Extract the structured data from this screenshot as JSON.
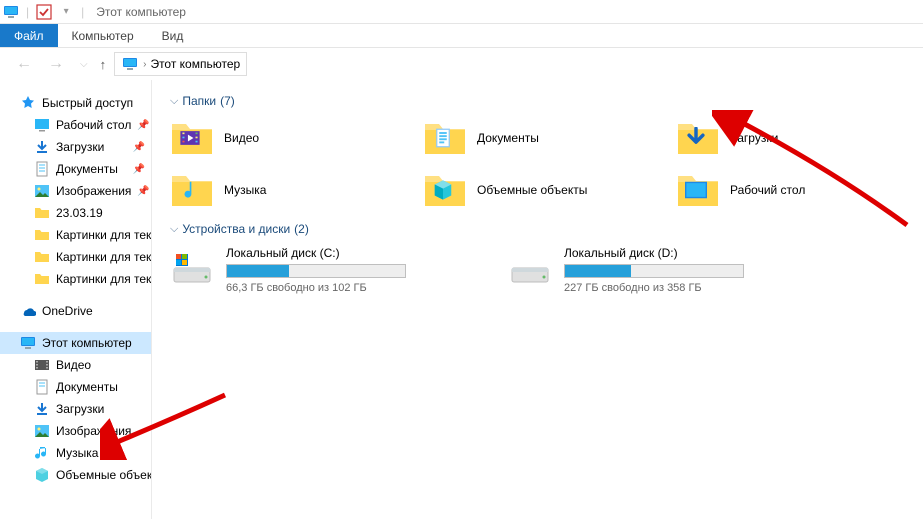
{
  "window": {
    "title": "Этот компьютер"
  },
  "ribbon": {
    "file": "Файл",
    "computer": "Компьютер",
    "view": "Вид"
  },
  "breadcrumb": {
    "root": "Этот компьютер"
  },
  "sidebar": {
    "quick_access": "Быстрый доступ",
    "qa": {
      "desktop": "Рабочий стол",
      "downloads": "Загрузки",
      "documents": "Документы",
      "pictures": "Изображения",
      "date_folder": "23.03.19",
      "pics1": "Картинки для текст",
      "pics2": "Картинки для текст",
      "pics3": "Картинки для текст"
    },
    "onedrive": "OneDrive",
    "this_pc": "Этот компьютер",
    "pc": {
      "videos": "Видео",
      "documents": "Документы",
      "downloads": "Загрузки",
      "pictures": "Изображения",
      "music": "Музыка",
      "objects3d": "Объемные объекты"
    }
  },
  "main": {
    "folders_header": "Папки",
    "folders_count": "(7)",
    "folders": {
      "videos": "Видео",
      "documents": "Документы",
      "downloads": "Загрузки",
      "music": "Музыка",
      "objects3d": "Объемные объекты",
      "desktop": "Рабочий стол"
    },
    "drives_header": "Устройства и диски",
    "drives_count": "(2)",
    "drive_c": {
      "name": "Локальный диск (C:)",
      "free": "66,3 ГБ свободно из 102 ГБ",
      "fill_pct": 35
    },
    "drive_d": {
      "name": "Локальный диск (D:)",
      "free": "227 ГБ свободно из 358 ГБ",
      "fill_pct": 37
    }
  }
}
